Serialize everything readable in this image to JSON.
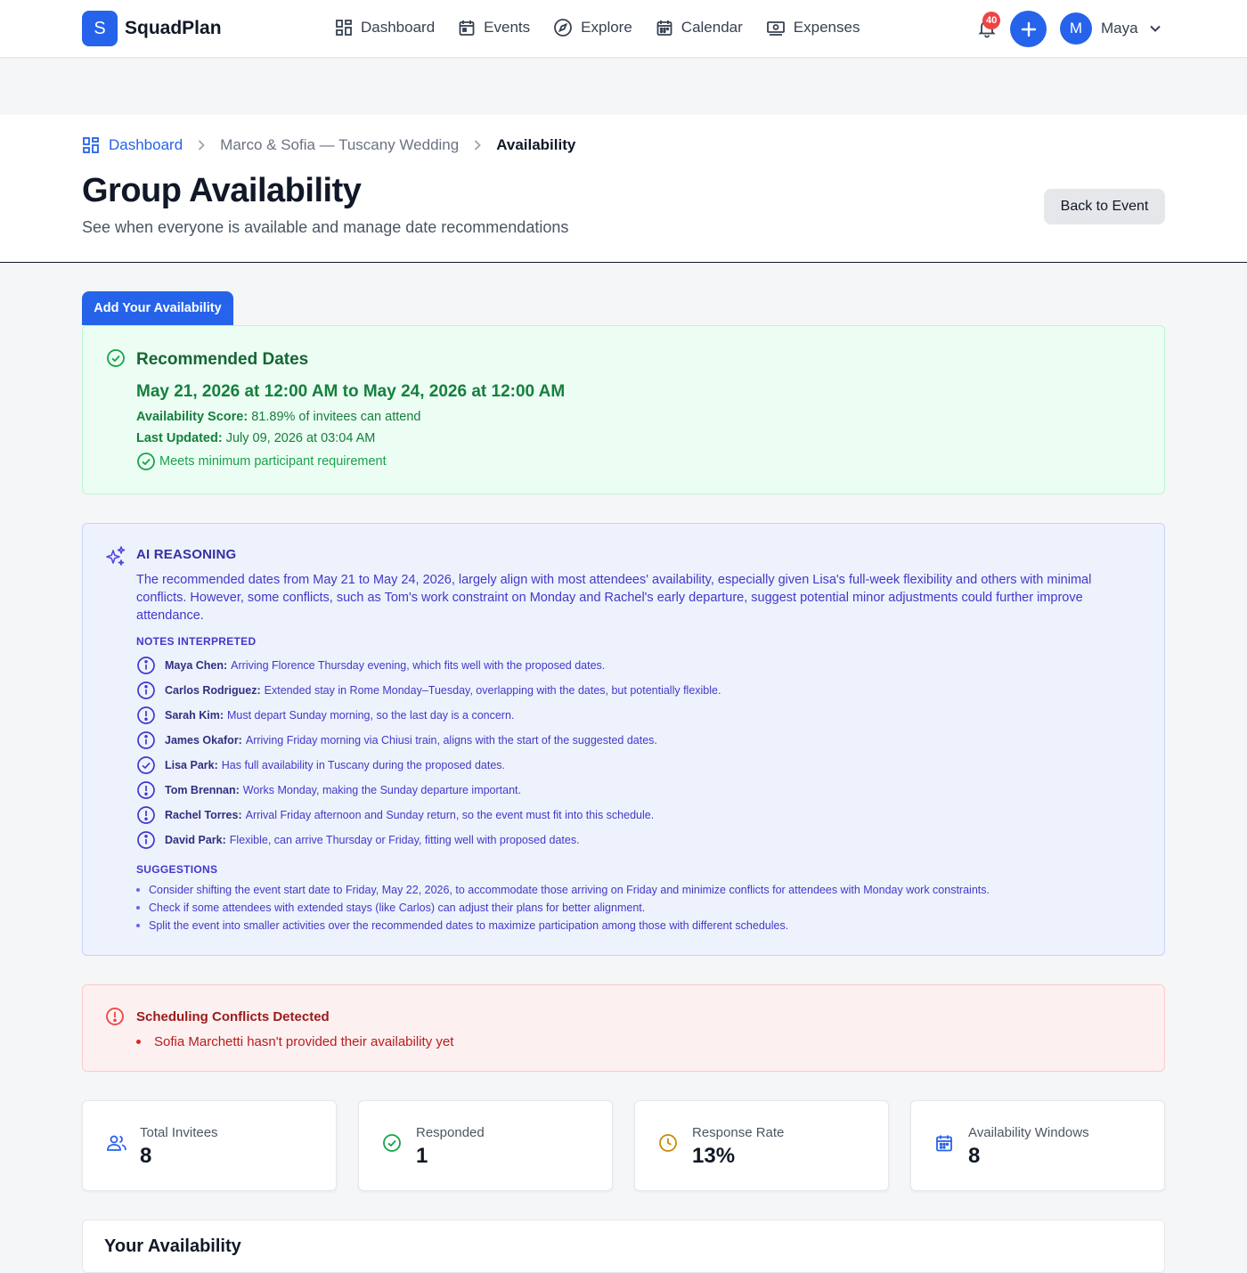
{
  "app": {
    "logo_letter": "S",
    "name": "SquadPlan"
  },
  "nav": {
    "items": [
      {
        "label": "Dashboard",
        "icon": "dashboard-grid-icon"
      },
      {
        "label": "Events",
        "icon": "event-calendar-icon"
      },
      {
        "label": "Explore",
        "icon": "compass-icon"
      },
      {
        "label": "Calendar",
        "icon": "calendar-icon"
      },
      {
        "label": "Expenses",
        "icon": "money-icon"
      }
    ],
    "notification_count": "40",
    "user_initial": "M",
    "user_name": "Maya"
  },
  "breadcrumb": {
    "home": "Dashboard",
    "event": "Marco & Sofia — Tuscany Wedding",
    "current": "Availability"
  },
  "header": {
    "title": "Group Availability",
    "subtitle": "See when everyone is available and manage date recommendations",
    "back_label": "Back to Event"
  },
  "add_availability_label": "Add Your Availability",
  "recommended": {
    "title": "Recommended Dates",
    "dates": "May 21, 2026 at 12:00 AM to May 24, 2026 at 12:00 AM",
    "score_label": "Availability Score:",
    "score_value": "81.89% of invitees can attend",
    "updated_label": "Last Updated:",
    "updated_value": "July 09, 2026 at 03:04 AM",
    "meets": "Meets minimum participant requirement"
  },
  "ai": {
    "title": "AI REASONING",
    "reasoning": "The recommended dates from May 21 to May 24, 2026, largely align with most attendees' availability, especially given Lisa's full-week flexibility and others with minimal conflicts. However, some conflicts, such as Tom's work constraint on Monday and Rachel's early departure, suggest potential minor adjustments could further improve attendance.",
    "notes_title": "NOTES INTERPRETED",
    "notes": [
      {
        "name": "Maya Chen:",
        "text": "Arriving Florence Thursday evening, which fits well with the proposed dates.",
        "icon": "info-icon"
      },
      {
        "name": "Carlos Rodriguez:",
        "text": "Extended stay in Rome Monday–Tuesday, overlapping with the dates, but potentially flexible.",
        "icon": "info-icon"
      },
      {
        "name": "Sarah Kim:",
        "text": "Must depart Sunday morning, so the last day is a concern.",
        "icon": "alert-icon"
      },
      {
        "name": "James Okafor:",
        "text": "Arriving Friday morning via Chiusi train, aligns with the start of the suggested dates.",
        "icon": "info-icon"
      },
      {
        "name": "Lisa Park:",
        "text": "Has full availability in Tuscany during the proposed dates.",
        "icon": "check-icon"
      },
      {
        "name": "Tom Brennan:",
        "text": "Works Monday, making the Sunday departure important.",
        "icon": "alert-icon"
      },
      {
        "name": "Rachel Torres:",
        "text": "Arrival Friday afternoon and Sunday return, so the event must fit into this schedule.",
        "icon": "alert-icon"
      },
      {
        "name": "David Park:",
        "text": "Flexible, can arrive Thursday or Friday, fitting well with proposed dates.",
        "icon": "info-icon"
      }
    ],
    "suggestions_title": "SUGGESTIONS",
    "suggestions": [
      "Consider shifting the event start date to Friday, May 22, 2026, to accommodate those arriving on Friday and minimize conflicts for attendees with Monday work constraints.",
      "Check if some attendees with extended stays (like Carlos) can adjust their plans for better alignment.",
      "Split the event into smaller activities over the recommended dates to maximize participation among those with different schedules."
    ]
  },
  "conflicts": {
    "title": "Scheduling Conflicts Detected",
    "items": [
      "Sofia Marchetti hasn't provided their availability yet"
    ]
  },
  "stats": [
    {
      "label": "Total Invitees",
      "value": "8",
      "icon": "users-icon",
      "color": "#2563eb"
    },
    {
      "label": "Responded",
      "value": "1",
      "icon": "check-circle-icon",
      "color": "#16a34a"
    },
    {
      "label": "Response Rate",
      "value": "13%",
      "icon": "clock-icon",
      "color": "#ca8a04"
    },
    {
      "label": "Availability Windows",
      "value": "8",
      "icon": "calendar-icon",
      "color": "#2563eb"
    }
  ],
  "your_availability_title": "Your Availability",
  "colors": {
    "accent": "#2563eb",
    "success": "#16a34a",
    "ai": "#4338ca",
    "danger": "#dc2626"
  }
}
